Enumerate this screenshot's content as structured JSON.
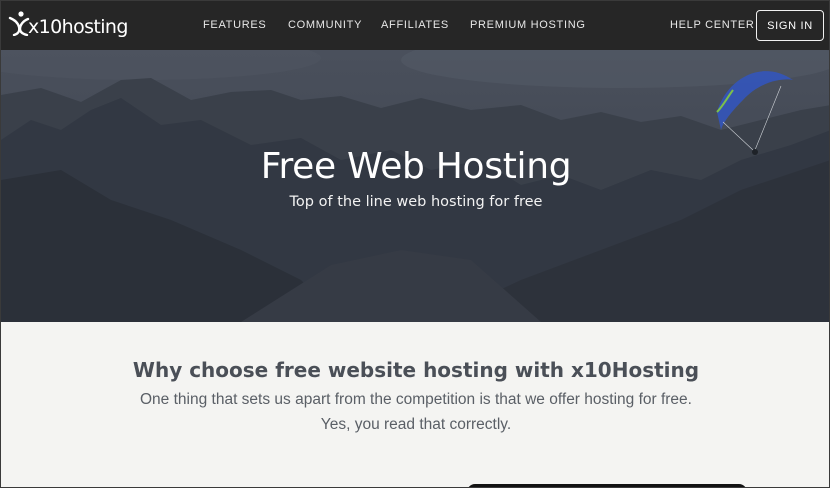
{
  "brand": {
    "logo_text": "x10hosting"
  },
  "nav": {
    "links": [
      {
        "label": "FEATURES"
      },
      {
        "label": "COMMUNITY"
      },
      {
        "label": "AFFILIATES"
      },
      {
        "label": "PREMIUM HOSTING"
      }
    ],
    "help_center": "HELP CENTER",
    "sign_in": "SIGN IN"
  },
  "hero": {
    "title": "Free Web Hosting",
    "subtitle": "Top of the line web hosting for free"
  },
  "why": {
    "title": "Why choose free website hosting with x10Hosting",
    "line1": "One thing that sets us apart from the competition is that we offer hosting for free.",
    "line2": "Yes, you read that correctly."
  },
  "colors": {
    "nav_bg": "#262626",
    "hero_overlay": "#3c4350",
    "section_bg": "#f4f4f2",
    "heading_text": "#4a4f57",
    "paraglider_wing": "#3355bb"
  },
  "icons": [
    "x10hosting-logo-icon",
    "paraglider-illustration"
  ]
}
